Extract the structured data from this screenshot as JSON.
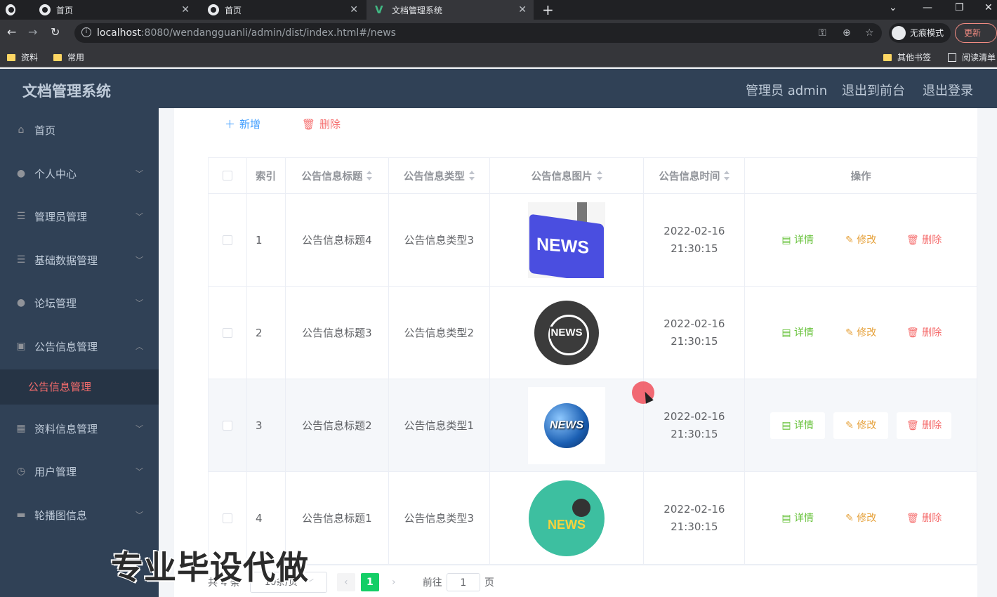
{
  "browser": {
    "tabs": [
      {
        "title": "首页"
      },
      {
        "title": "首页"
      },
      {
        "title": "文档管理系统"
      }
    ],
    "url_host": "localhost",
    "url_rest": ":8080/wendangguanli/admin/dist/index.html#/news",
    "incognito_label": "无痕模式",
    "update_label": "更新",
    "bookmarks": [
      "资料",
      "常用",
      "其他书签",
      "阅读清单"
    ]
  },
  "header": {
    "title": "文档管理系统",
    "user_label": "管理员 admin",
    "to_front_label": "退出到前台",
    "logout_label": "退出登录"
  },
  "sidebar": {
    "items": [
      {
        "label": "首页",
        "icon": "home-icon"
      },
      {
        "label": "个人中心",
        "icon": "user-icon"
      },
      {
        "label": "管理员管理",
        "icon": "list-icon"
      },
      {
        "label": "基础数据管理",
        "icon": "list-icon"
      },
      {
        "label": "论坛管理",
        "icon": "user-icon"
      },
      {
        "label": "公告信息管理",
        "icon": "clipboard-icon"
      },
      {
        "label": "资料信息管理",
        "icon": "grid-icon"
      },
      {
        "label": "用户管理",
        "icon": "clock-icon"
      },
      {
        "label": "轮播图信息",
        "icon": "monitor-icon"
      }
    ],
    "active_sub": "公告信息管理"
  },
  "toolbar": {
    "add_label": "新增",
    "delete_label": "删除"
  },
  "table": {
    "headers": [
      "索引",
      "公告信息标题",
      "公告信息类型",
      "公告信息图片",
      "公告信息时间",
      "操作"
    ],
    "rows": [
      {
        "index": "1",
        "title": "公告信息标题4",
        "type": "公告信息类型3",
        "time": "2022-02-16 21:30:15"
      },
      {
        "index": "2",
        "title": "公告信息标题3",
        "type": "公告信息类型2",
        "time": "2022-02-16 21:30:15"
      },
      {
        "index": "3",
        "title": "公告信息标题2",
        "type": "公告信息类型1",
        "time": "2022-02-16 21:30:15"
      },
      {
        "index": "4",
        "title": "公告信息标题1",
        "type": "公告信息类型3",
        "time": "2022-02-16 21:30:15"
      }
    ],
    "actions": {
      "detail": "详情",
      "edit": "修改",
      "remove": "删除"
    },
    "image_texts": [
      "NEWS",
      "NEWS",
      "NEWS",
      "NEWS"
    ]
  },
  "pagination": {
    "total_label": "共 4 条",
    "page_size": "10条/页",
    "current_page": "1",
    "goto_prefix": "前往",
    "goto_value": "1",
    "goto_suffix": "页"
  },
  "watermark": "专业毕设代做"
}
